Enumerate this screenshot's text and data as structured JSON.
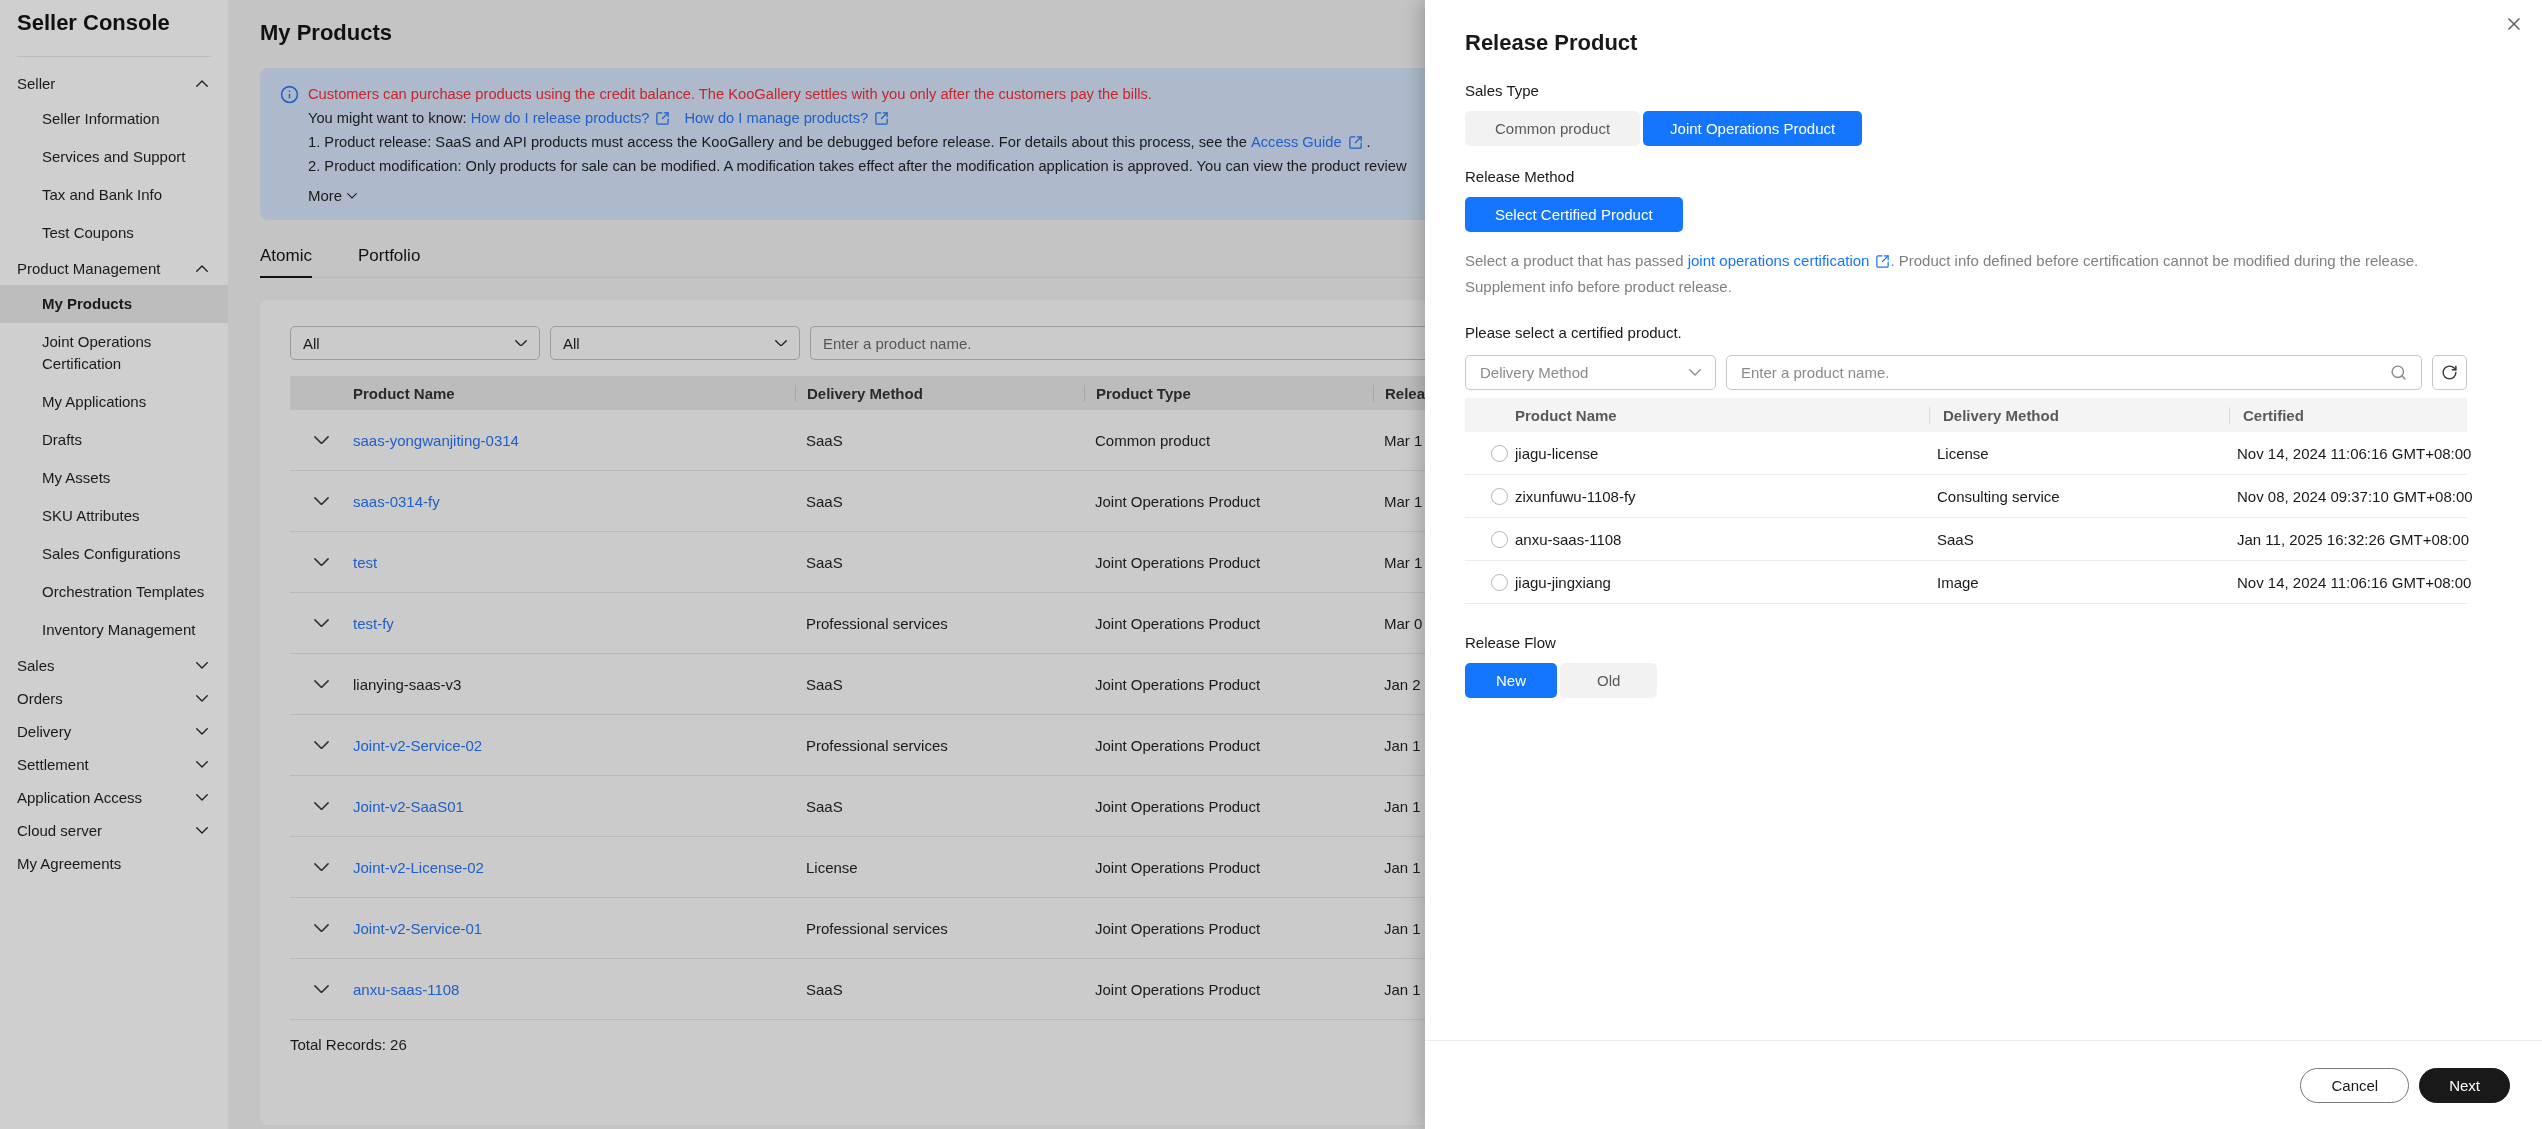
{
  "sidebar": {
    "title": "Seller Console",
    "items": [
      {
        "kind": "group",
        "label": "Seller",
        "expanded": true,
        "children": [
          {
            "label": "Seller Information",
            "selected": false
          },
          {
            "label": "Services and Support",
            "selected": false
          },
          {
            "label": "Tax and Bank Info",
            "selected": false
          },
          {
            "label": "Test Coupons",
            "selected": false
          }
        ]
      },
      {
        "kind": "group",
        "label": "Product Management",
        "expanded": true,
        "children": [
          {
            "label": "My Products",
            "selected": true
          },
          {
            "label": "Joint Operations Certification",
            "selected": false
          },
          {
            "label": "My Applications",
            "selected": false
          },
          {
            "label": "Drafts",
            "selected": false
          },
          {
            "label": "My Assets",
            "selected": false
          },
          {
            "label": "SKU Attributes",
            "selected": false
          },
          {
            "label": "Sales Configurations",
            "selected": false
          },
          {
            "label": "Orchestration Templates",
            "selected": false
          },
          {
            "label": "Inventory Management",
            "selected": false
          }
        ]
      },
      {
        "kind": "group",
        "label": "Sales",
        "expanded": false
      },
      {
        "kind": "group",
        "label": "Orders",
        "expanded": false
      },
      {
        "kind": "group",
        "label": "Delivery",
        "expanded": false
      },
      {
        "kind": "group",
        "label": "Settlement",
        "expanded": false
      },
      {
        "kind": "group",
        "label": "Application Access",
        "expanded": false
      },
      {
        "kind": "group",
        "label": "Cloud server",
        "expanded": false
      },
      {
        "kind": "link",
        "label": "My Agreements"
      }
    ]
  },
  "page": {
    "title": "My Products",
    "notice": {
      "warning": "Customers can purchase products using the credit balance. The KooGallery settles with you only after the customers pay the bills.",
      "know_label": "You might want to know:",
      "know_links": [
        "How do I release products?",
        "How do I manage products?"
      ],
      "lines": [
        {
          "text": "1. Product release: SaaS and API products must access the KooGallery and be debugged before release. For details about this process, see the ",
          "link": "Access Guide",
          "suffix": " ."
        },
        {
          "text": "2. Product modification: Only products for sale can be modified. A modification takes effect after the modification application is approved. You can view the product review"
        }
      ],
      "more": "More"
    },
    "tabs": [
      {
        "label": "Atomic",
        "selected": true
      },
      {
        "label": "Portfolio",
        "selected": false
      }
    ],
    "filters": {
      "selects": [
        "All",
        "All"
      ],
      "search_placeholder": "Enter a product name."
    },
    "table": {
      "columns": [
        "Product Name",
        "Delivery Method",
        "Product Type",
        "Relea"
      ],
      "rows": [
        {
          "name": "saas-yongwanjiting-0314",
          "linked": true,
          "delivery": "SaaS",
          "type": "Common product",
          "release": "Mar 1"
        },
        {
          "name": "saas-0314-fy",
          "linked": true,
          "delivery": "SaaS",
          "type": "Joint Operations Product",
          "release": "Mar 1"
        },
        {
          "name": "test",
          "linked": true,
          "delivery": "SaaS",
          "type": "Joint Operations Product",
          "release": "Mar 1"
        },
        {
          "name": "test-fy",
          "linked": true,
          "delivery": "Professional services",
          "type": "Joint Operations Product",
          "release": "Mar 0"
        },
        {
          "name": "lianying-saas-v3",
          "linked": false,
          "delivery": "SaaS",
          "type": "Joint Operations Product",
          "release": "Jan 2"
        },
        {
          "name": "Joint-v2-Service-02",
          "linked": true,
          "delivery": "Professional services",
          "type": "Joint Operations Product",
          "release": "Jan 1"
        },
        {
          "name": "Joint-v2-SaaS01",
          "linked": true,
          "delivery": "SaaS",
          "type": "Joint Operations Product",
          "release": "Jan 1"
        },
        {
          "name": "Joint-v2-License-02",
          "linked": true,
          "delivery": "License",
          "type": "Joint Operations Product",
          "release": "Jan 1"
        },
        {
          "name": "Joint-v2-Service-01",
          "linked": true,
          "delivery": "Professional services",
          "type": "Joint Operations Product",
          "release": "Jan 1"
        },
        {
          "name": "anxu-saas-1108",
          "linked": true,
          "delivery": "SaaS",
          "type": "Joint Operations Product",
          "release": "Jan 1"
        }
      ],
      "total": "Total Records: 26"
    }
  },
  "drawer": {
    "title": "Release Product",
    "sales_type": {
      "label": "Sales Type",
      "options": [
        {
          "label": "Common product",
          "selected": false
        },
        {
          "label": "Joint Operations Product",
          "selected": true
        }
      ]
    },
    "release_method": {
      "label": "Release Method",
      "button": "Select Certified Product",
      "hint_before": "Select a product that has passed ",
      "hint_link": "joint operations certification",
      "hint_after": ". Product info defined before certification cannot be modified during the release.",
      "hint_line2": "Supplement info before product release."
    },
    "select_label": "Please select a certified product.",
    "filters": {
      "select_placeholder": "Delivery Method",
      "search_placeholder": "Enter a product name."
    },
    "table": {
      "columns": [
        "Product Name",
        "Delivery Method",
        "Certified"
      ],
      "rows": [
        {
          "name": "jiagu-license",
          "delivery": "License",
          "certified": "Nov 14, 2024 11:06:16 GMT+08:00",
          "selected": false
        },
        {
          "name": "zixunfuwu-1108-fy",
          "delivery": "Consulting service",
          "certified": "Nov 08, 2024 09:37:10 GMT+08:00",
          "selected": false
        },
        {
          "name": "anxu-saas-1108",
          "delivery": "SaaS",
          "certified": "Jan 11, 2025 16:32:26 GMT+08:00",
          "selected": false
        },
        {
          "name": "jiagu-jingxiang",
          "delivery": "Image",
          "certified": "Nov 14, 2024 11:06:16 GMT+08:00",
          "selected": false
        }
      ]
    },
    "release_flow": {
      "label": "Release Flow",
      "options": [
        {
          "label": "New",
          "selected": true
        },
        {
          "label": "Old",
          "selected": false
        }
      ]
    },
    "buttons": {
      "cancel": "Cancel",
      "next": "Next"
    }
  }
}
